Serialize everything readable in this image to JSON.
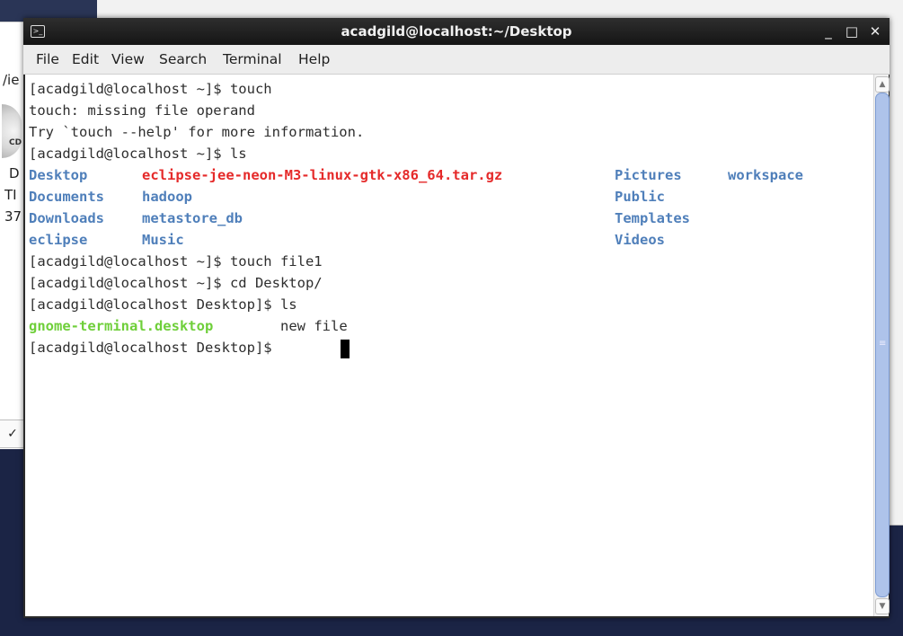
{
  "window": {
    "title": "acadgild@localhost:~/Desktop",
    "minimize": "_",
    "maximize": "□",
    "close": "✕"
  },
  "menu": [
    "File",
    "Edit",
    "View",
    "Search",
    "Terminal",
    "Help"
  ],
  "background_fragments": [
    "/ie",
    "D",
    "TI",
    "37",
    "CD",
    "✓"
  ],
  "terminal": {
    "lines": [
      "[acadgild@localhost ~]$ touch",
      "touch: missing file operand",
      "Try `touch --help' for more information.",
      "[acadgild@localhost ~]$ ls"
    ],
    "ls_home": [
      [
        "Desktop",
        "eclipse-jee-neon-M3-linux-gtk-x86_64.tar.gz",
        "Pictures",
        "workspace"
      ],
      [
        "Documents",
        "hadoop",
        "Public",
        ""
      ],
      [
        "Downloads",
        "metastore_db",
        "Templates",
        ""
      ],
      [
        "eclipse",
        "Music",
        "Videos",
        ""
      ]
    ],
    "after": [
      "[acadgild@localhost ~]$ touch file1",
      "[acadgild@localhost ~]$ cd Desktop/",
      "[acadgild@localhost Desktop]$ ls"
    ],
    "ls_desktop": [
      "gnome-terminal.desktop",
      "new file"
    ],
    "prompt": "[acadgild@localhost Desktop]$ "
  },
  "colors": {
    "directory": "#4f7fba",
    "archive": "#e52a2a",
    "executable": "#6fcf3a",
    "scroll_thumb": "#aec3ea"
  }
}
